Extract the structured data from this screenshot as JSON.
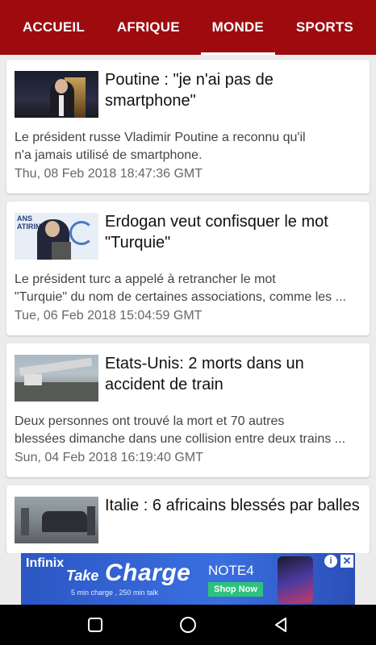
{
  "tabs": [
    {
      "label": "ACCUEIL",
      "active": false
    },
    {
      "label": "AFRIQUE",
      "active": false
    },
    {
      "label": "MONDE",
      "active": true
    },
    {
      "label": "SPORTS",
      "active": false
    }
  ],
  "articles": [
    {
      "title": "Poutine : \"je n'ai pas de smartphone\"",
      "summary_line1": "Le président russe Vladimir Poutine a reconnu qu'il",
      "summary_line2": "n'a jamais utilisé de smartphone.",
      "date": "Thu, 08 Feb 2018 18:47:36 GMT"
    },
    {
      "title": "Erdogan veut confisquer le mot \"Turquie\"",
      "summary_line1": "Le président turc a appelé à retrancher le mot",
      "summary_line2": "\"Turquie\" du nom de certaines associations, comme les ...",
      "date": "Tue, 06 Feb 2018 15:04:59 GMT",
      "thumb_text": "ANS\nATIRIM"
    },
    {
      "title": "Etats-Unis: 2 morts dans un accident de train",
      "summary_line1": "Deux personnes ont trouvé la mort et 70 autres",
      "summary_line2": "blessées dimanche dans une collision entre deux trains ...",
      "date": "Sun, 04 Feb 2018 16:19:40 GMT"
    },
    {
      "title": "Italie : 6 africains blessés par balles"
    }
  ],
  "ad": {
    "brand": "Infinix",
    "take": "Take",
    "charge": "Charge",
    "model": "NOTE4",
    "subtext": "5 min charge , 250 min talk",
    "cta": "Shop Now",
    "info_glyph": "i",
    "close_glyph": "✕"
  },
  "colors": {
    "tabbar": "#9e0b0f",
    "background": "#ececec"
  },
  "icons": {
    "nav_recents": "square-icon",
    "nav_home": "circle-icon",
    "nav_back": "triangle-back-icon"
  }
}
